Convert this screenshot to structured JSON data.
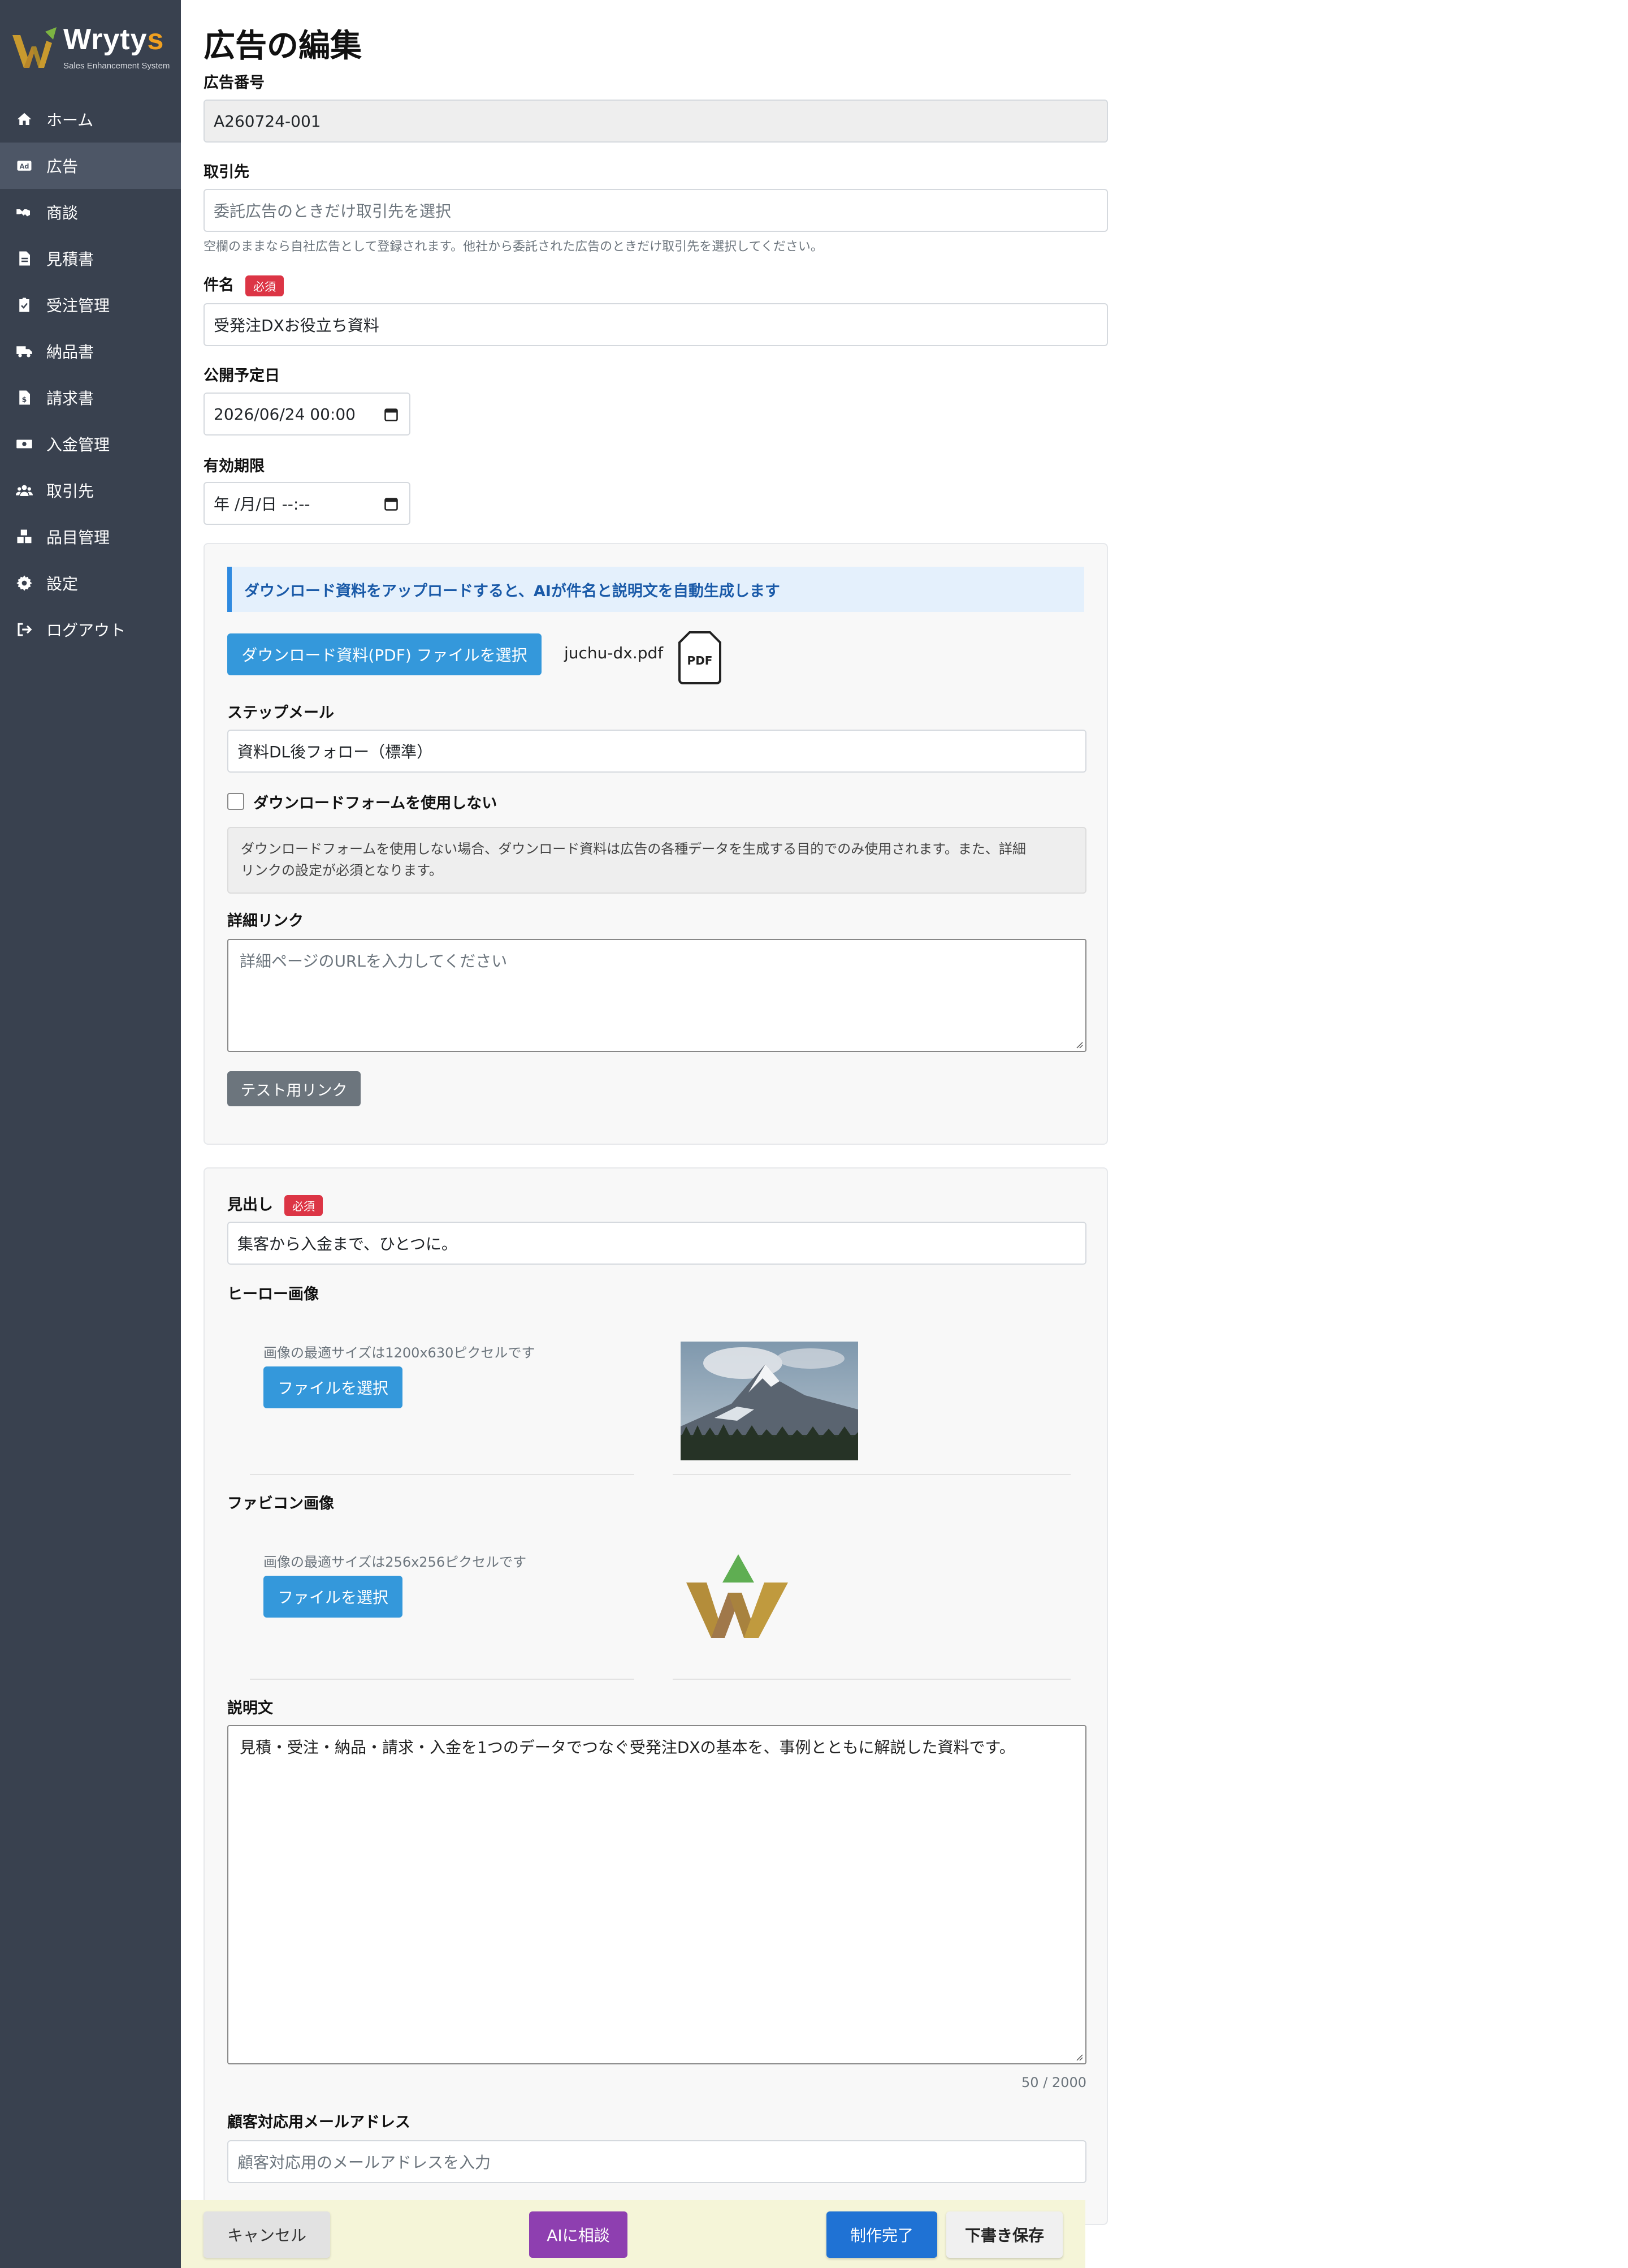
{
  "app": {
    "logo_text_main": "Wryty",
    "logo_text_accent": "s",
    "logo_subtitle": "Sales Enhancement System"
  },
  "sidebar": {
    "items": [
      {
        "label": "ホーム",
        "icon": "home-icon",
        "active": false
      },
      {
        "label": "広告",
        "icon": "ad-icon",
        "active": true
      },
      {
        "label": "商談",
        "icon": "handshake-icon",
        "active": false
      },
      {
        "label": "見積書",
        "icon": "document-icon",
        "active": false
      },
      {
        "label": "受注管理",
        "icon": "clipboard-check-icon",
        "active": false
      },
      {
        "label": "納品書",
        "icon": "truck-icon",
        "active": false
      },
      {
        "label": "請求書",
        "icon": "invoice-icon",
        "active": false
      },
      {
        "label": "入金管理",
        "icon": "money-icon",
        "active": false
      },
      {
        "label": "取引先",
        "icon": "users-icon",
        "active": false
      },
      {
        "label": "品目管理",
        "icon": "boxes-icon",
        "active": false
      },
      {
        "label": "設定",
        "icon": "gear-icon",
        "active": false
      },
      {
        "label": "ログアウト",
        "icon": "logout-icon",
        "active": false
      }
    ]
  },
  "page": {
    "title": "広告の編集"
  },
  "form": {
    "ad_number": {
      "label": "広告番号",
      "value": "A260724-001"
    },
    "client": {
      "label": "取引先",
      "placeholder": "委託広告のときだけ取引先を選択",
      "help": "空欄のままなら自社広告として登録されます。他社から委託された広告のときだけ取引先を選択してください。"
    },
    "subject": {
      "label": "件名",
      "required_badge": "必須",
      "value": "受発注DXお役立ち資料"
    },
    "publish_date": {
      "label": "公開予定日",
      "value": "2026/06/24 00:00"
    },
    "expiry": {
      "label": "有効期限",
      "value": "年 /月/日 --:--"
    },
    "download": {
      "ai_banner": "ダウンロード資料をアップロードすると、AIが件名と説明文を自動生成します",
      "upload_button": "ダウンロード資料(PDF) ファイルを選択",
      "file_name": "juchu-dx.pdf",
      "file_icon_text": "PDF",
      "step_mail_label": "ステップメール",
      "step_mail_value": "資料DL後フォロー（標準）",
      "no_form_label": "ダウンロードフォームを使用しない",
      "no_form_checked": false,
      "notice_line1": "ダウンロードフォームを使用しない場合、ダウンロード資料は広告の各種データを生成する目的でのみ使用されます。また、詳細",
      "notice_line2": "リンクの設定が必須となります。",
      "detail_link_label": "詳細リンク",
      "detail_link_placeholder": "詳細ページのURLを入力してください",
      "test_link_button": "テスト用リンク"
    },
    "content": {
      "headline_label": "見出し",
      "headline_badge": "必須",
      "headline_value": "集客から入金まで、ひとつに。",
      "hero_label": "ヒーロー画像",
      "hero_help": "画像の最適サイズは1200x630ピクセルです",
      "hero_button": "ファイルを選択",
      "favicon_label": "ファビコン画像",
      "favicon_help": "画像の最適サイズは256x256ピクセルです",
      "favicon_button": "ファイルを選択",
      "description_label": "説明文",
      "description_value": "見積・受注・納品・請求・入金を1つのデータでつなぐ受発注DXの基本を、事例とともに解説した資料です。",
      "description_counter": "50 / 2000",
      "email_label": "顧客対応用メールアドレス",
      "email_placeholder": "顧客対応用のメールアドレスを入力"
    }
  },
  "actions": {
    "cancel": "キャンセル",
    "ai_consult": "AIに相談",
    "complete": "制作完了",
    "save_draft": "下書き保存"
  },
  "colors": {
    "sidebar_bg": "#39414f",
    "primary": "#3498db",
    "required_badge": "#dc3545",
    "ai_button": "#8e3fb0",
    "complete_button": "#1f72d4"
  }
}
